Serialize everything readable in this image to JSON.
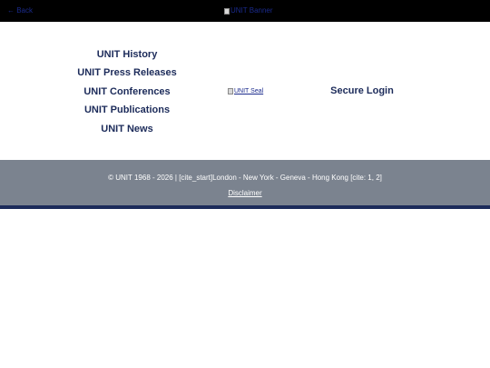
{
  "header": {
    "back_label": "← Back",
    "banner_alt": "UNIT Banner"
  },
  "nav": {
    "items": [
      {
        "label": "UNIT History"
      },
      {
        "label": "UNIT Press Releases"
      },
      {
        "label": "UNIT Conferences"
      },
      {
        "label": "UNIT Publications"
      },
      {
        "label": "UNIT News"
      }
    ]
  },
  "seal": {
    "alt": "UNIT Seal"
  },
  "login": {
    "label": "Secure Login"
  },
  "footer": {
    "copyright": "© UNIT 1968 - 2026 | [cite_start]London - New York - Geneva - Hong Kong [cite: 1, 2]",
    "disclaimer": "Disclaimer"
  },
  "colors": {
    "topbar": "#000000",
    "nav_text": "#1c2b5a",
    "footer_bg": "#7b838f",
    "footer_strip": "#1c2b5a",
    "link": "#1a2a8c"
  }
}
